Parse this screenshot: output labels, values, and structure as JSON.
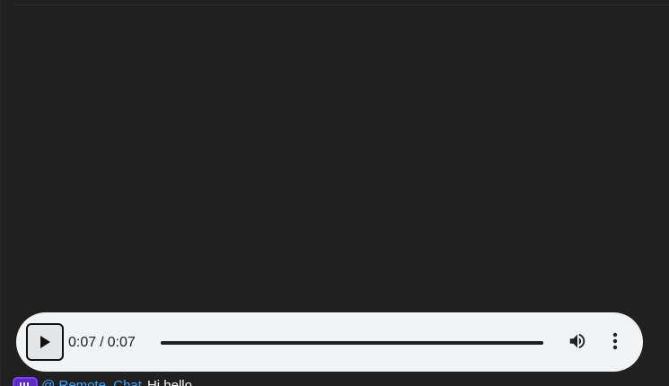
{
  "player": {
    "play_icon": "play-icon",
    "current_time": "0:07",
    "separator": "/",
    "duration": "0:07",
    "progress_percent": 100,
    "volume_icon": "volume-up-icon",
    "more_icon": "more-vert-icon"
  },
  "colors": {
    "page_background": "#202020",
    "player_background": "#f1f3f4",
    "player_foreground": "#202124",
    "link": "#3ea6ff",
    "app_icon": "#5b2dbf"
  },
  "footer": {
    "app_icon": "app-icon",
    "link_text": "@ Remote_Chat",
    "message_text": "Hi hello"
  }
}
